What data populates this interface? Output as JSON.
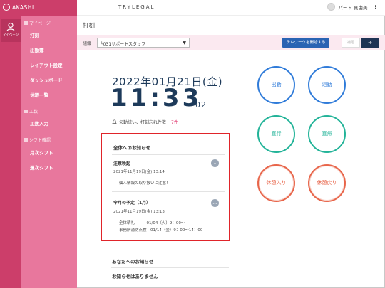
{
  "brand": {
    "name": "AKASHI"
  },
  "rail": {
    "label": "マイページ",
    "icon": "person-icon"
  },
  "sidebar": {
    "sections": [
      {
        "title": "マイページ",
        "items": [
          "打刻",
          "出勤簿",
          "レイアウト設定",
          "ダッシュボード",
          "休暇一覧"
        ]
      },
      {
        "title": "工数",
        "items": [
          "工数入力"
        ]
      },
      {
        "title": "シフト確認",
        "items": [
          "月次シフト",
          "週次シフト"
        ]
      }
    ]
  },
  "header": {
    "product": "TRYLEGAL",
    "user_name": "パート 真由美",
    "menu_icon": "kebab-icon"
  },
  "page": {
    "title": "打刻"
  },
  "toolbar": {
    "org_label": "組織",
    "org_value": "└031サポートスタッフ",
    "telework_button": "テレワークを開始する",
    "sub_button": "補足",
    "dark_button_icon": "login-arrow-icon"
  },
  "clock": {
    "date": "2022年01月21日(金)",
    "time": "11:33",
    "seconds": "02"
  },
  "alerts": {
    "label": "欠勤続い、打刻忘れ件数",
    "count": "7件"
  },
  "notices": {
    "heading": "全体へのお知らせ",
    "items": [
      {
        "title": "注意喚起",
        "date": "2021年11月19日(金) 13:14",
        "lines": [
          "個人情報の取り扱いに注意！"
        ]
      },
      {
        "title": "今月の予定（1月）",
        "date": "2021年11月19日(金) 13:13",
        "lines": [
          "全体朝礼　　　01/04（火）9：00～",
          "事務所消防点検　01/14（金）9：00～14：00"
        ]
      }
    ]
  },
  "my_notices": {
    "heading": "あなたへのお知らせ",
    "empty": "お知らせはありません"
  },
  "punch": {
    "clock_in": "出勤",
    "clock_out": "退勤",
    "direct_go": "直行",
    "direct_return": "直帰",
    "break_in": "休憩入り",
    "break_out": "休憩戻り"
  },
  "colors": {
    "accent": "#cc3e6a",
    "sidebar": "#e8779d",
    "blue": "#2f7bd9",
    "teal": "#22b398",
    "red": "#e8654a",
    "highlight": "#e0242a"
  }
}
